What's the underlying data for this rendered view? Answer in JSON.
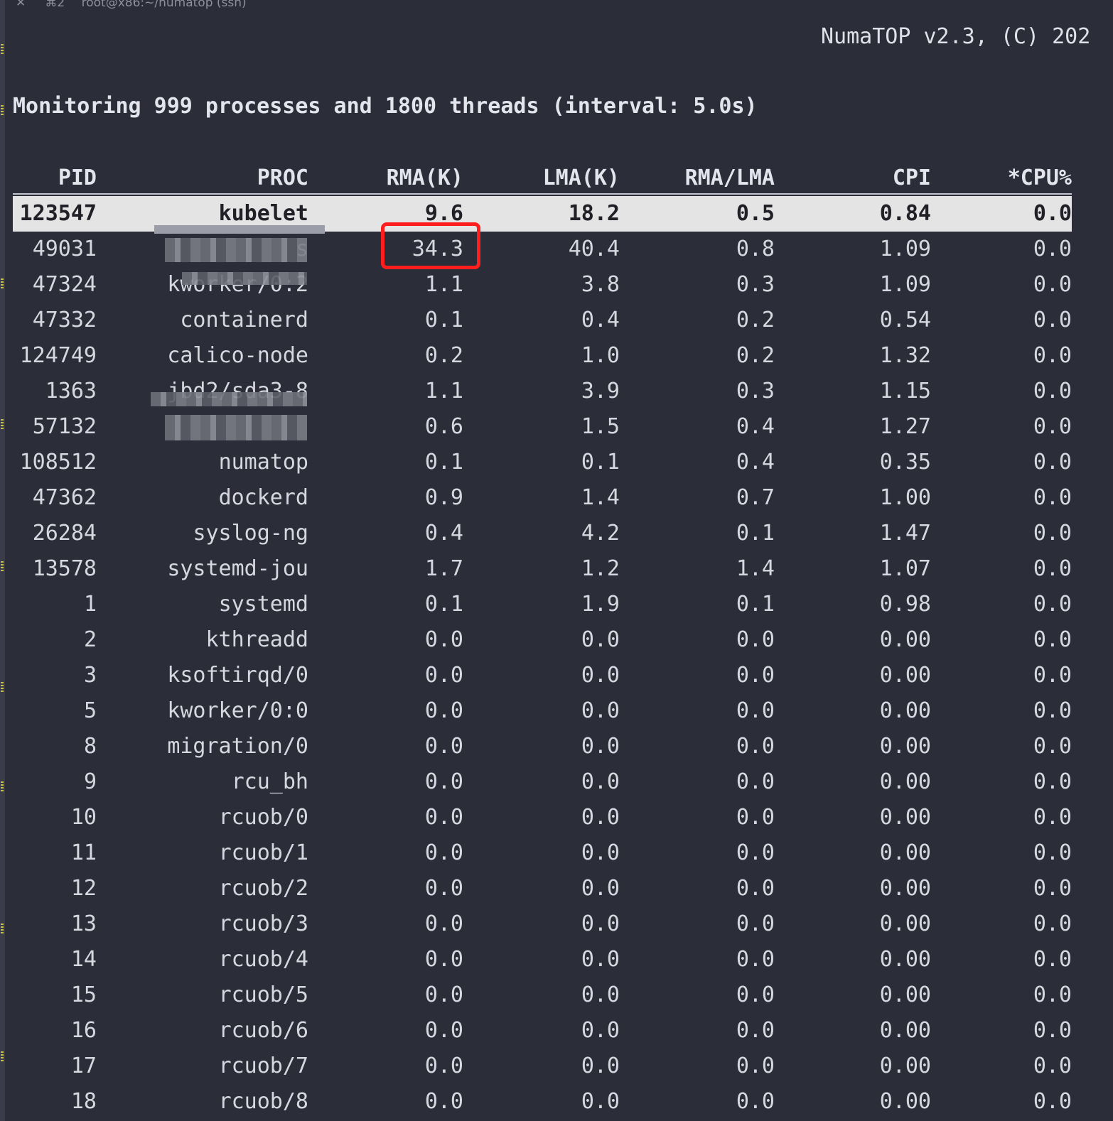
{
  "window": {
    "shortcut": "⌘2",
    "title": "root@x86:~/numatop (ssh)"
  },
  "app_title": "NumaTOP v2.3, (C) 202",
  "summary": "Monitoring 999 processes and 1800 threads (interval: 5.0s)",
  "table": {
    "headers": [
      "PID",
      "PROC",
      "RMA(K)",
      "LMA(K)",
      "RMA/LMA",
      "CPI",
      "*CPU%"
    ],
    "rows": [
      [
        "123547",
        "kubelet",
        "9.6",
        "18.2",
        "0.5",
        "0.84",
        "0.0"
      ],
      [
        "49031",
        "s",
        "34.3",
        "40.4",
        "0.8",
        "1.09",
        "0.0"
      ],
      [
        "47324",
        "kworker/0:2",
        "1.1",
        "3.8",
        "0.3",
        "1.09",
        "0.0"
      ],
      [
        "47332",
        "containerd",
        "0.1",
        "0.4",
        "0.2",
        "0.54",
        "0.0"
      ],
      [
        "124749",
        "calico-node",
        "0.2",
        "1.0",
        "0.2",
        "1.32",
        "0.0"
      ],
      [
        "1363",
        "jbd2/sda3-8",
        "1.1",
        "3.9",
        "0.3",
        "1.15",
        "0.0"
      ],
      [
        "57132",
        "",
        "0.6",
        "1.5",
        "0.4",
        "1.27",
        "0.0"
      ],
      [
        "108512",
        "numatop",
        "0.1",
        "0.1",
        "0.4",
        "0.35",
        "0.0"
      ],
      [
        "47362",
        "dockerd",
        "0.9",
        "1.4",
        "0.7",
        "1.00",
        "0.0"
      ],
      [
        "26284",
        "syslog-ng",
        "0.4",
        "4.2",
        "0.1",
        "1.47",
        "0.0"
      ],
      [
        "13578",
        "systemd-jou",
        "1.7",
        "1.2",
        "1.4",
        "1.07",
        "0.0"
      ],
      [
        "1",
        "systemd",
        "0.1",
        "1.9",
        "0.1",
        "0.98",
        "0.0"
      ],
      [
        "2",
        "kthreadd",
        "0.0",
        "0.0",
        "0.0",
        "0.00",
        "0.0"
      ],
      [
        "3",
        "ksoftirqd/0",
        "0.0",
        "0.0",
        "0.0",
        "0.00",
        "0.0"
      ],
      [
        "5",
        "kworker/0:0",
        "0.0",
        "0.0",
        "0.0",
        "0.00",
        "0.0"
      ],
      [
        "8",
        "migration/0",
        "0.0",
        "0.0",
        "0.0",
        "0.00",
        "0.0"
      ],
      [
        "9",
        "rcu_bh",
        "0.0",
        "0.0",
        "0.0",
        "0.00",
        "0.0"
      ],
      [
        "10",
        "rcuob/0",
        "0.0",
        "0.0",
        "0.0",
        "0.00",
        "0.0"
      ],
      [
        "11",
        "rcuob/1",
        "0.0",
        "0.0",
        "0.0",
        "0.00",
        "0.0"
      ],
      [
        "12",
        "rcuob/2",
        "0.0",
        "0.0",
        "0.0",
        "0.00",
        "0.0"
      ],
      [
        "13",
        "rcuob/3",
        "0.0",
        "0.0",
        "0.0",
        "0.00",
        "0.0"
      ],
      [
        "14",
        "rcuob/4",
        "0.0",
        "0.0",
        "0.0",
        "0.00",
        "0.0"
      ],
      [
        "15",
        "rcuob/5",
        "0.0",
        "0.0",
        "0.0",
        "0.00",
        "0.0"
      ],
      [
        "16",
        "rcuob/6",
        "0.0",
        "0.0",
        "0.0",
        "0.00",
        "0.0"
      ],
      [
        "17",
        "rcuob/7",
        "0.0",
        "0.0",
        "0.0",
        "0.00",
        "0.0"
      ],
      [
        "18",
        "rcuob/8",
        "0.0",
        "0.0",
        "0.0",
        "0.00",
        "0.0"
      ]
    ]
  },
  "colors": {
    "background": "#2b2d38",
    "text": "#d6d8df",
    "selected_row_bg": "#e4e4e4",
    "highlight_border": "#ff1e1e"
  }
}
